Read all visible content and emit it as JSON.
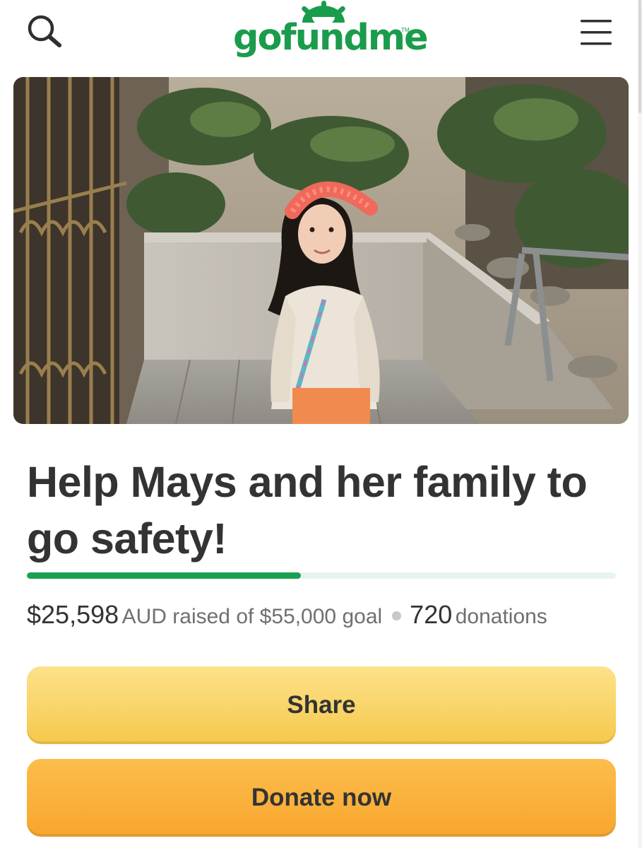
{
  "header": {
    "logo_text": "gofundme",
    "logo_trademark": "TM",
    "search_icon": "search-icon",
    "menu_icon": "hamburger-menu-icon"
  },
  "hero": {
    "image_subject": "girl-with-red-headband-photo"
  },
  "campaign": {
    "title": "Help Mays and her family to go safety!",
    "progress_fraction": 0.465,
    "raised_amount": "$25,598",
    "raised_suffix": "AUD raised of $55,000 goal",
    "donations_count": "720",
    "donations_label": "donations"
  },
  "actions": {
    "share_label": "Share",
    "donate_label": "Donate now"
  },
  "colors": {
    "brand_green": "#1a9c4c",
    "progress_fill": "#1aa053",
    "progress_track": "#e6f5ec",
    "share_button": "#f9d465",
    "donate_button": "#fbb03f",
    "text_dark": "#333333",
    "text_muted": "#6f6f6f"
  }
}
